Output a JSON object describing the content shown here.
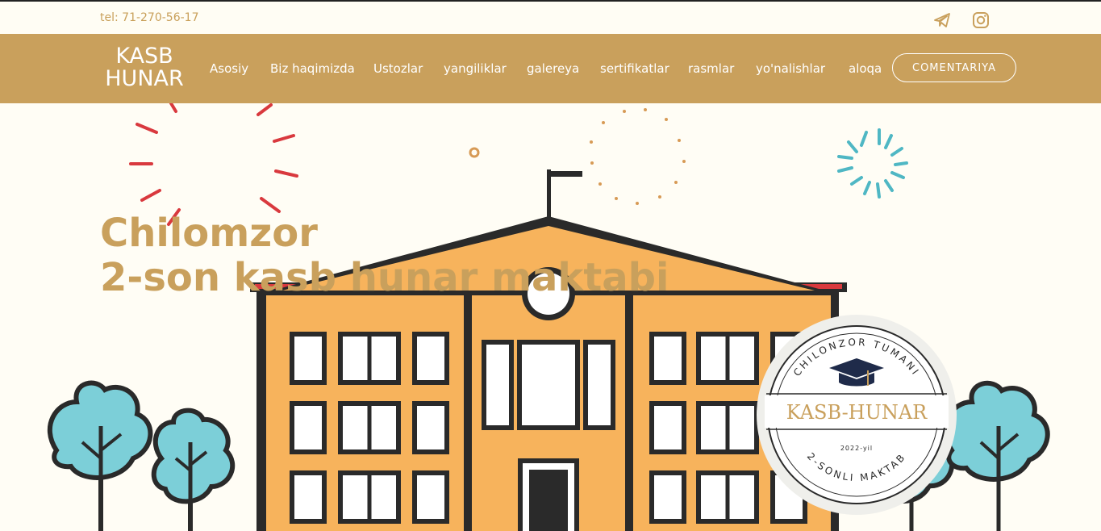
{
  "topbar": {
    "phone": "tel: 71-270-56-17",
    "social": [
      {
        "icon": "telegram-icon"
      },
      {
        "icon": "instagram-icon"
      }
    ]
  },
  "nav": {
    "brand_line1": "KASB",
    "brand_line2": "HUNAR",
    "items": [
      {
        "label": "Asosiy"
      },
      {
        "label": "Biz haqimizda"
      },
      {
        "label": "Ustozlar"
      },
      {
        "label": "yangiliklar"
      },
      {
        "label": "galereya"
      },
      {
        "label": "sertifikatlar"
      },
      {
        "label": "rasmlar"
      },
      {
        "label": "yo'nalishlar"
      },
      {
        "label": "aloqa"
      }
    ],
    "cta": "COMENTARIYA"
  },
  "hero": {
    "title_line1": "Chilomzor",
    "title_line2": "2-son kasb hunar maktabi",
    "badge": {
      "top_text": "CHILONZOR TUMANI",
      "main_text": "KASB-HUNAR",
      "year_text": "2022-yil",
      "bottom_text": "2-SONLI MAKTAB"
    }
  },
  "colors": {
    "accent": "#c9a05c",
    "background": "#fffdf5",
    "building": "#f7b35c",
    "tree": "#7ccfd8",
    "firework_red": "#d9393e",
    "firework_teal": "#4fb7c4"
  }
}
